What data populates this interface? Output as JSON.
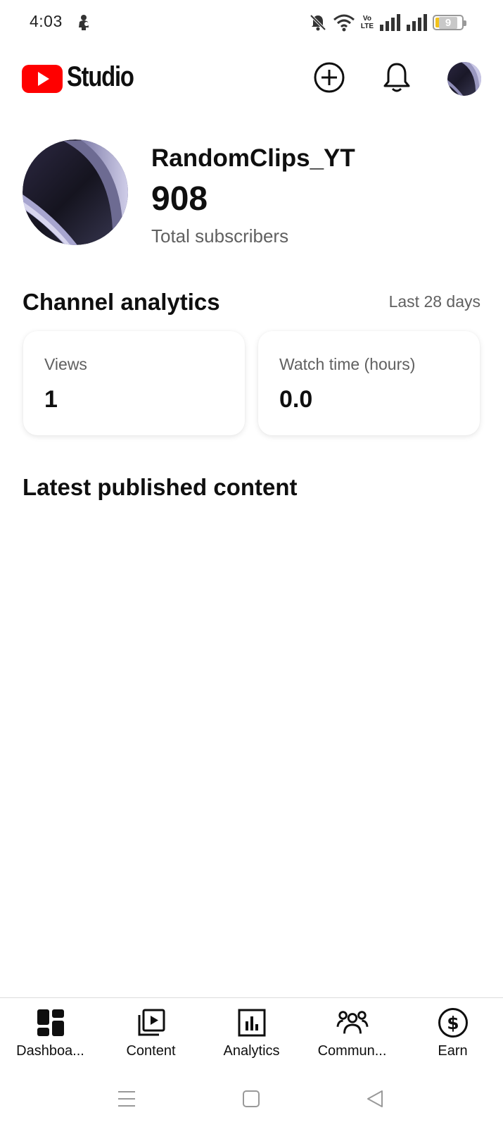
{
  "status_bar": {
    "time": "4:03",
    "battery_level": "9",
    "network_label_top": "Vo",
    "network_label_bottom": "LTE",
    "icons": [
      "person-icon",
      "bell-muted-icon",
      "wifi-icon",
      "volte-icon",
      "signal-icon",
      "signal-icon",
      "battery-icon"
    ]
  },
  "header": {
    "app_name": "Studio",
    "logo_icon": "youtube-play-icon",
    "create_icon": "add-circle-icon",
    "notifications_icon": "bell-icon"
  },
  "channel": {
    "name": "RandomClips_YT",
    "subscriber_count": "908",
    "subscriber_label": "Total subscribers"
  },
  "analytics": {
    "title": "Channel analytics",
    "period": "Last 28 days",
    "cards": [
      {
        "label": "Views",
        "value": "1"
      },
      {
        "label": "Watch time (hours)",
        "value": "0.0"
      }
    ]
  },
  "latest": {
    "title": "Latest published content"
  },
  "bottom_nav": {
    "items": [
      {
        "label": "Dashboa...",
        "icon": "dashboard-icon"
      },
      {
        "label": "Content",
        "icon": "content-icon"
      },
      {
        "label": "Analytics",
        "icon": "analytics-icon"
      },
      {
        "label": "Commun...",
        "icon": "community-icon"
      },
      {
        "label": "Earn",
        "icon": "earn-icon"
      }
    ]
  },
  "system_nav": {
    "icons": [
      "menu-icon",
      "home-icon",
      "back-icon"
    ]
  },
  "colors": {
    "brand_red": "#ff0000",
    "text_primary": "#0f0f0f",
    "text_secondary": "#606060",
    "battery": "#f2c21b"
  }
}
